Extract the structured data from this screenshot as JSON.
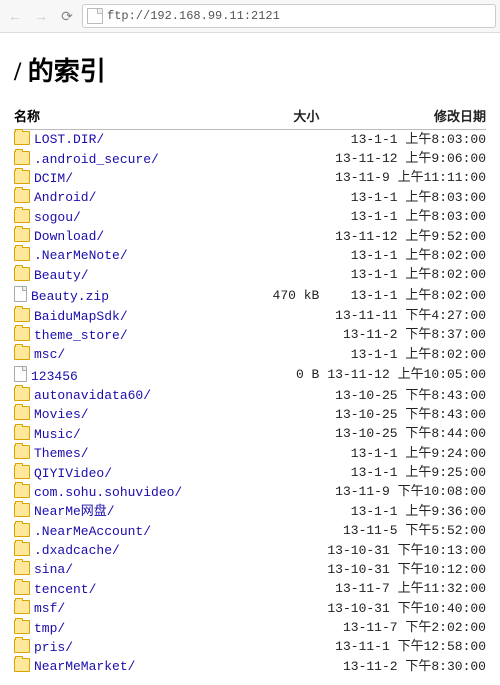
{
  "toolbar": {
    "url": "ftp://192.168.99.11:2121"
  },
  "page": {
    "title": "/ 的索引"
  },
  "headers": {
    "name": "名称",
    "size": "大小",
    "date": "修改日期"
  },
  "entries": [
    {
      "type": "folder",
      "name": "LOST.DIR/",
      "size": "",
      "date": "13-1-1 上午8:03:00"
    },
    {
      "type": "folder",
      "name": ".android_secure/",
      "size": "",
      "date": "13-11-12 上午9:06:00"
    },
    {
      "type": "folder",
      "name": "DCIM/",
      "size": "",
      "date": "13-11-9 上午11:11:00"
    },
    {
      "type": "folder",
      "name": "Android/",
      "size": "",
      "date": "13-1-1 上午8:03:00"
    },
    {
      "type": "folder",
      "name": "sogou/",
      "size": "",
      "date": "13-1-1 上午8:03:00"
    },
    {
      "type": "folder",
      "name": "Download/",
      "size": "",
      "date": "13-11-12 上午9:52:00"
    },
    {
      "type": "folder",
      "name": ".NearMeNote/",
      "size": "",
      "date": "13-1-1 上午8:02:00"
    },
    {
      "type": "folder",
      "name": "Beauty/",
      "size": "",
      "date": "13-1-1 上午8:02:00"
    },
    {
      "type": "file",
      "name": "Beauty.zip",
      "size": "470 kB",
      "date": "13-1-1 上午8:02:00"
    },
    {
      "type": "folder",
      "name": "BaiduMapSdk/",
      "size": "",
      "date": "13-11-11 下午4:27:00"
    },
    {
      "type": "folder",
      "name": "theme_store/",
      "size": "",
      "date": "13-11-2 下午8:37:00"
    },
    {
      "type": "folder",
      "name": "msc/",
      "size": "",
      "date": "13-1-1 上午8:02:00"
    },
    {
      "type": "file",
      "name": "123456",
      "size": "0 B",
      "date": "13-11-12 上午10:05:00"
    },
    {
      "type": "folder",
      "name": "autonavidata60/",
      "size": "",
      "date": "13-10-25 下午8:43:00"
    },
    {
      "type": "folder",
      "name": "Movies/",
      "size": "",
      "date": "13-10-25 下午8:43:00"
    },
    {
      "type": "folder",
      "name": "Music/",
      "size": "",
      "date": "13-10-25 下午8:44:00"
    },
    {
      "type": "folder",
      "name": "Themes/",
      "size": "",
      "date": "13-1-1 上午9:24:00"
    },
    {
      "type": "folder",
      "name": "QIYIVideo/",
      "size": "",
      "date": "13-1-1 上午9:25:00"
    },
    {
      "type": "folder",
      "name": "com.sohu.sohuvideo/",
      "size": "",
      "date": "13-11-9 下午10:08:00"
    },
    {
      "type": "folder",
      "name": "NearMe网盘/",
      "size": "",
      "date": "13-1-1 上午9:36:00"
    },
    {
      "type": "folder",
      "name": ".NearMeAccount/",
      "size": "",
      "date": "13-11-5 下午5:52:00"
    },
    {
      "type": "folder",
      "name": ".dxadcache/",
      "size": "",
      "date": "13-10-31 下午10:13:00"
    },
    {
      "type": "folder",
      "name": "sina/",
      "size": "",
      "date": "13-10-31 下午10:12:00"
    },
    {
      "type": "folder",
      "name": "tencent/",
      "size": "",
      "date": "13-11-7 上午11:32:00"
    },
    {
      "type": "folder",
      "name": "msf/",
      "size": "",
      "date": "13-10-31 下午10:40:00"
    },
    {
      "type": "folder",
      "name": "tmp/",
      "size": "",
      "date": "13-11-7 下午2:02:00"
    },
    {
      "type": "folder",
      "name": "pris/",
      "size": "",
      "date": "13-11-1 下午12:58:00"
    },
    {
      "type": "folder",
      "name": "NearMeMarket/",
      "size": "",
      "date": "13-11-2 下午8:30:00"
    }
  ]
}
